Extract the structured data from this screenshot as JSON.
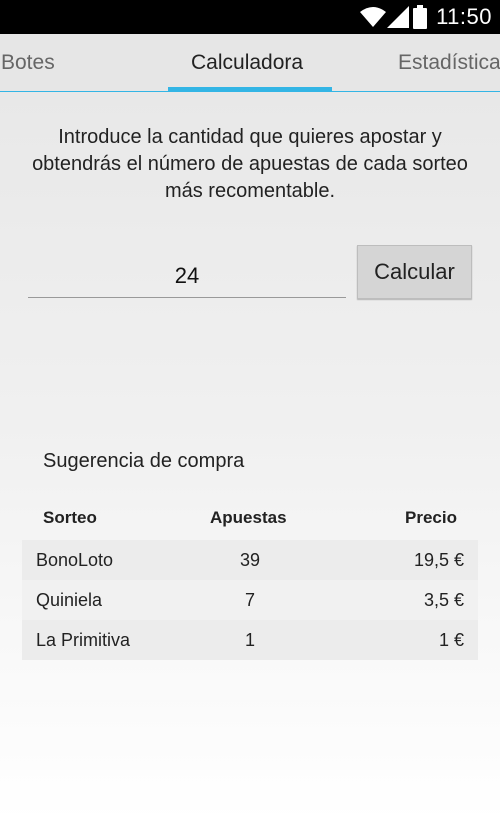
{
  "status_bar": {
    "time": "11:50",
    "icons": [
      "wifi-icon",
      "signal-icon",
      "battery-icon"
    ]
  },
  "tabs": [
    {
      "label": "Botes",
      "active": false
    },
    {
      "label": "Calculadora",
      "active": true
    },
    {
      "label": "Estadística",
      "active": false
    }
  ],
  "colors": {
    "accent": "#33b5e5",
    "status_bar": "#000000",
    "button": "#d5d5d5"
  },
  "calculator": {
    "intro": "Introduce la cantidad que quieres apostar y obtendrás el número de apuestas de cada sorteo más recomentable.",
    "amount_value": "24",
    "calculate_label": "Calcular"
  },
  "suggestion": {
    "title": "Sugerencia de compra",
    "headers": {
      "sorteo": "Sorteo",
      "apuestas": "Apuestas",
      "precio": "Precio"
    },
    "rows": [
      {
        "sorteo": "BonoLoto",
        "apuestas": "39",
        "precio": "19,5 €"
      },
      {
        "sorteo": "Quiniela",
        "apuestas": "7",
        "precio": "3,5 €"
      },
      {
        "sorteo": "La Primitiva",
        "apuestas": "1",
        "precio": "1 €"
      }
    ]
  }
}
